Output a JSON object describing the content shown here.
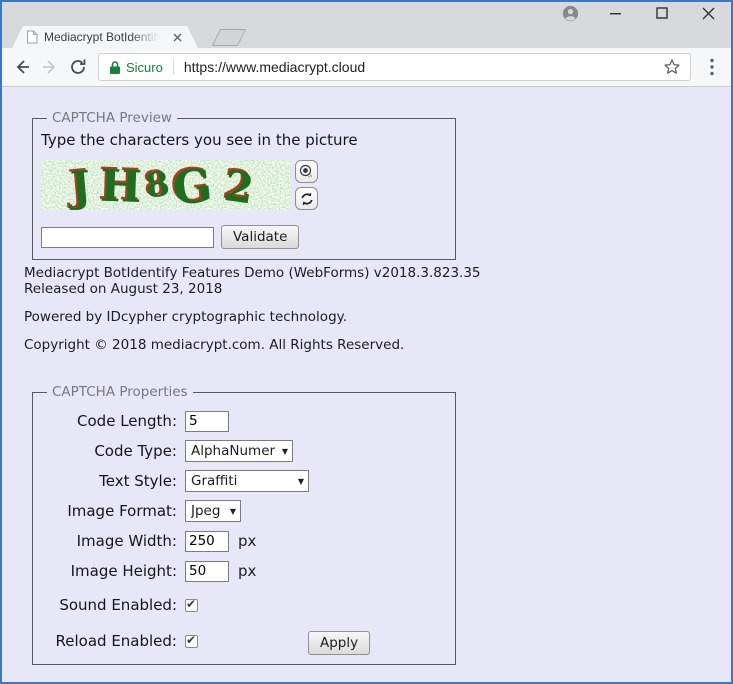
{
  "window": {
    "controls": [
      "profile",
      "minimize",
      "maximize",
      "close"
    ]
  },
  "browser": {
    "tab": {
      "title": "Mediacrypt BotIdentify Fe"
    },
    "toolbar": {
      "secure_label": "Sicuro",
      "url": "https://www.mediacrypt.cloud"
    }
  },
  "page": {
    "preview": {
      "legend": "CAPTCHA Preview",
      "instruction": "Type the characters you see in the picture",
      "captcha_code": "JH8G2",
      "captcha_chars": [
        "J",
        "H",
        "8",
        "G",
        "2"
      ],
      "input_value": "",
      "validate_label": "Validate"
    },
    "info": {
      "version_line1": "Mediacrypt BotIdentify Features Demo (WebForms) v2018.3.823.35",
      "version_line2": "Released on August 23, 2018",
      "powered": "Powered by IDcypher cryptographic technology.",
      "copyright": "Copyright © 2018 mediacrypt.com. All Rights Reserved."
    },
    "properties": {
      "legend": "CAPTCHA Properties",
      "rows": [
        {
          "label": "Code Length:",
          "type": "input",
          "value": "5"
        },
        {
          "label": "Code Type:",
          "type": "select",
          "value": "AlphaNumeric"
        },
        {
          "label": "Text Style:",
          "type": "select",
          "value": "Graffiti"
        },
        {
          "label": "Image Format:",
          "type": "select",
          "value": "Jpeg"
        },
        {
          "label": "Image Width:",
          "type": "input",
          "value": "250",
          "suffix": "px"
        },
        {
          "label": "Image Height:",
          "type": "input",
          "value": "50",
          "suffix": "px"
        },
        {
          "label": "Sound Enabled:",
          "type": "checkbox",
          "checked": true
        },
        {
          "label": "Reload Enabled:",
          "type": "checkbox",
          "checked": true
        }
      ],
      "apply_label": "Apply"
    },
    "icons": {
      "lock": "green-padlock",
      "sound_button": "speaker",
      "reload_button": "refresh-arrows",
      "bookmark": "star-outline",
      "menu": "vertical-three-dots"
    },
    "colors": {
      "page_background": "#e8e7f8",
      "secure_green": "#188038",
      "captcha_text_green": "#1f6d1f",
      "captcha_shadow_red": "#ab3e23",
      "window_border_blue": "#3c78c0"
    }
  }
}
